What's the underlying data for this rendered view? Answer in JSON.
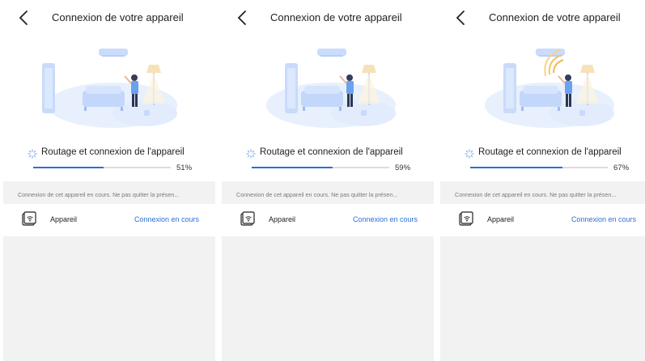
{
  "panels": [
    {
      "title": "Connexion de votre appareil",
      "status": "Routage et connexion de l'appareil",
      "progress": 0.51,
      "progress_text": "51%",
      "note": "Connexion de cet appareil en cours. Ne pas quitter la présen...",
      "device_label": "Appareil",
      "device_status": "Connexion en cours",
      "wifi_waves": false
    },
    {
      "title": "Connexion de votre appareil",
      "status": "Routage et connexion de l'appareil",
      "progress": 0.59,
      "progress_text": "59%",
      "note": "Connexion de cet appareil en cours. Ne pas quitter la présen...",
      "device_label": "Appareil",
      "device_status": "Connexion en cours",
      "wifi_waves": false
    },
    {
      "title": "Connexion de votre appareil",
      "status": "Routage et connexion de l'appareil",
      "progress": 0.67,
      "progress_text": "67%",
      "note": "Connexion de cet appareil en cours. Ne pas quitter la présen...",
      "device_label": "Appareil",
      "device_status": "Connexion en cours",
      "wifi_waves": true
    }
  ],
  "colors": {
    "accent": "#2e6fd6",
    "background_gray": "#f2f2f2",
    "illustration_blue": "#cfe0fb"
  },
  "icons": [
    "back-arrow-icon",
    "loading-spinner-icon",
    "wifi-device-icon"
  ]
}
